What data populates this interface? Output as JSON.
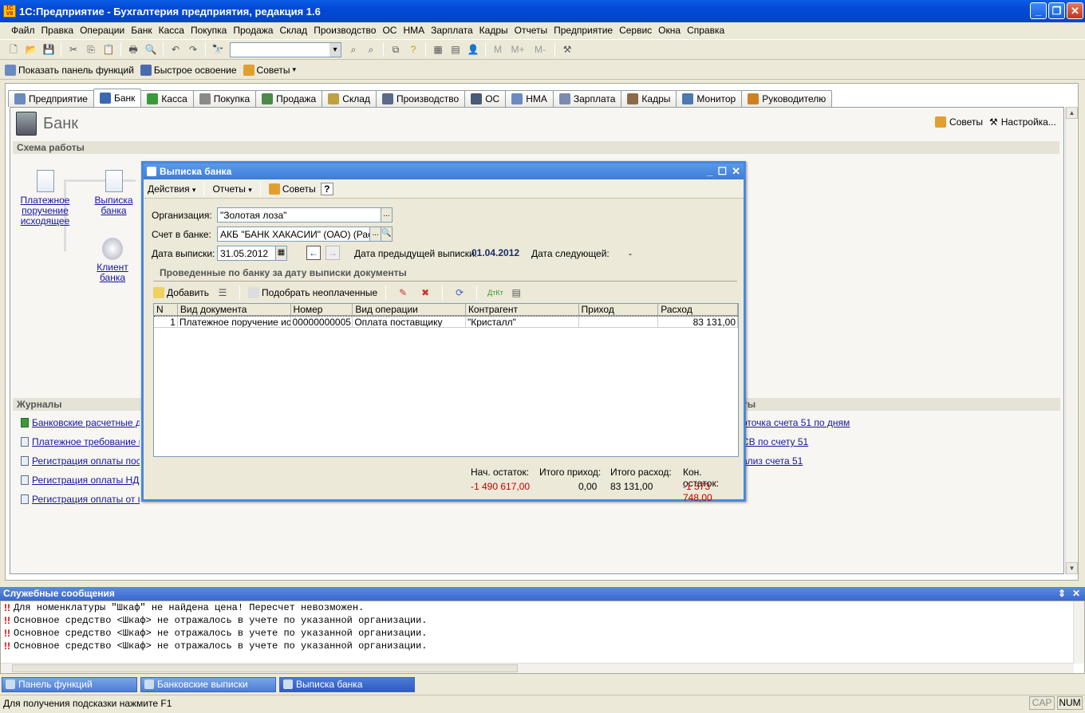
{
  "app": {
    "title": "1С:Предприятие - Бухгалтерия предприятия, редакция 1.6",
    "logo_text": "1C V8",
    "colors": {
      "title_bar": "#0349D6",
      "link": "#1515A0",
      "negative": "#C00000"
    }
  },
  "menu": [
    "Файл",
    "Правка",
    "Операции",
    "Банк",
    "Касса",
    "Покупка",
    "Продажа",
    "Склад",
    "Производство",
    "ОС",
    "НМА",
    "Зарплата",
    "Кадры",
    "Отчеты",
    "Предприятие",
    "Сервис",
    "Окна",
    "Справка"
  ],
  "toolbar2": {
    "show_panel": "Показать панель функций",
    "quick_start": "Быстрое освоение",
    "tips": "Советы"
  },
  "tabs": [
    "Предприятие",
    "Банк",
    "Касса",
    "Покупка",
    "Продажа",
    "Склад",
    "Производство",
    "ОС",
    "НМА",
    "Зарплата",
    "Кадры",
    "Монитор",
    "Руководителю"
  ],
  "active_tab": "Банк",
  "panel": {
    "title": "Банк",
    "tips": "Советы",
    "settings": "Настройка...",
    "scheme_header": "Схема работы",
    "scheme_items": [
      "Платежное поручение исходящее",
      "Выписка банка",
      "Клиент банка"
    ],
    "journals_header": "Журналы",
    "journals": [
      "Банковские расчетные до",
      "Платежное требование вы",
      "Регистрация оплаты пост",
      "Регистрация оплаты НДС",
      "Регистрация оплаты от по"
    ],
    "reports_header": "ты",
    "reports": [
      "рточка счета 51 по дням",
      "СВ по счету 51",
      "ализ счета 51"
    ]
  },
  "dialog": {
    "title": "Выписка банка",
    "toolbar": {
      "actions": "Действия",
      "reports": "Отчеты",
      "tips": "Советы",
      "help": "?"
    },
    "org_label": "Организация:",
    "org_value": "\"Золотая лоза\"",
    "account_label": "Счет в банке:",
    "account_value": "АКБ \"БАНК ХАКАСИИ\" (ОАО) (Расчет",
    "date_label": "Дата выписки:",
    "date_value": "31.05.2012",
    "prev_date_label": "Дата предыдущей выписки:",
    "prev_date_value": "01.04.2012",
    "next_date_label": "Дата следующей:",
    "next_date_value": "-",
    "section_title": "Проведенные по банку за дату выписки документы",
    "add_label": "Добавить",
    "select_unpaid": "Подобрать неоплаченные",
    "columns": [
      "N",
      "Вид документа",
      "Номер",
      "Вид операции",
      "Контрагент",
      "Приход",
      "Расход"
    ],
    "rows": [
      {
        "n": "1",
        "doc": "Платежное поручение ис...",
        "num": "00000000005",
        "op": "Оплата поставщику",
        "contr": "\"Кристалл\"",
        "in": "",
        "out": "83 131,00"
      }
    ],
    "totals": {
      "start_label": "Нач. остаток:",
      "start_value": "-1 490 617,00",
      "in_label": "Итого приход:",
      "in_value": "0,00",
      "out_label": "Итого расход:",
      "out_value": "83 131,00",
      "end_label": "Кон. остаток:",
      "end_value": "-1 573 748,00"
    }
  },
  "messages": {
    "title": "Служебные сообщения",
    "lines": [
      "Для номенклатуры \"Шкаф\" не найдена цена! Пересчет невозможен.",
      "Основное средство <Шкаф> не отражалось в учете по указанной организации.",
      "Основное средство <Шкаф> не отражалось в учете по указанной организации.",
      "Основное средство <Шкаф> не отражалось в учете по указанной организации."
    ]
  },
  "taskbar": [
    "Панель функций",
    "Банковские выписки",
    "Выписка банка"
  ],
  "status": {
    "hint": "Для получения подсказки нажмите F1",
    "cap": "CAP",
    "num": "NUM"
  }
}
